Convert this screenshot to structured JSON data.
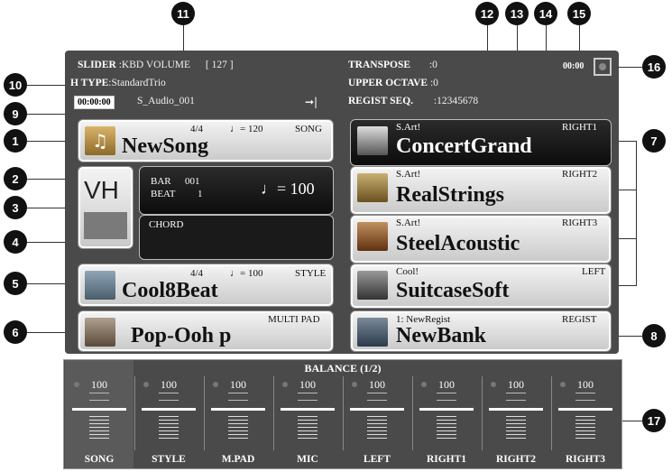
{
  "header": {
    "slider_label": "SLIDER",
    "slider_value": ":KBD VOLUME",
    "slider_num": "[    127    ]",
    "vh_label": "H TYPE",
    "vh_value": ":StandardTrio",
    "time": "00:00:00",
    "audio_file": "S_Audio_001",
    "transpose_label": "TRANSPOSE",
    "transpose_value": ":0",
    "upper_octave_label": "UPPER OCTAVE",
    "upper_octave_value": ":0",
    "regist_seq_label": "REGIST SEQ.",
    "regist_seq_value": ":12345678",
    "clock": "00:00"
  },
  "song": {
    "meter": "4/4",
    "tempo": "♩= 120",
    "tag": "SONG",
    "name": "NewSong"
  },
  "vh": {
    "label": "VH"
  },
  "bar_beat": {
    "bar_label": "BAR",
    "bar_value": "001",
    "beat_label": "BEAT",
    "beat_value": "1",
    "tempo": "♩= 100"
  },
  "chord": {
    "label": "CHORD"
  },
  "style": {
    "meter": "4/4",
    "tempo": "♩= 100",
    "tag": "STYLE",
    "name": "Cool8Beat"
  },
  "multipad": {
    "tag": "MULTI PAD",
    "name": "Pop-Ooh p"
  },
  "voices": [
    {
      "prefix": "S.Art!",
      "part": "RIGHT1",
      "name": "ConcertGrand"
    },
    {
      "prefix": "S.Art!",
      "part": "RIGHT2",
      "name": "RealStrings"
    },
    {
      "prefix": "S.Art!",
      "part": "RIGHT3",
      "name": "SteelAcoustic"
    },
    {
      "prefix": "Cool!",
      "part": "LEFT",
      "name": "SuitcaseSoft"
    }
  ],
  "regist": {
    "prefix": "1: NewRegist",
    "tag": "REGIST",
    "name": "NewBank"
  },
  "balance": {
    "title": "BALANCE (1/2)",
    "channels": [
      {
        "label": "SONG",
        "value": "100"
      },
      {
        "label": "STYLE",
        "value": "100"
      },
      {
        "label": "M.PAD",
        "value": "100"
      },
      {
        "label": "MIC",
        "value": "100"
      },
      {
        "label": "LEFT",
        "value": "100"
      },
      {
        "label": "RIGHT1",
        "value": "100"
      },
      {
        "label": "RIGHT2",
        "value": "100"
      },
      {
        "label": "RIGHT3",
        "value": "100"
      }
    ]
  },
  "callouts": [
    "1",
    "2",
    "3",
    "4",
    "5",
    "6",
    "7",
    "8",
    "9",
    "10",
    "11",
    "12",
    "13",
    "14",
    "15",
    "16",
    "17"
  ]
}
